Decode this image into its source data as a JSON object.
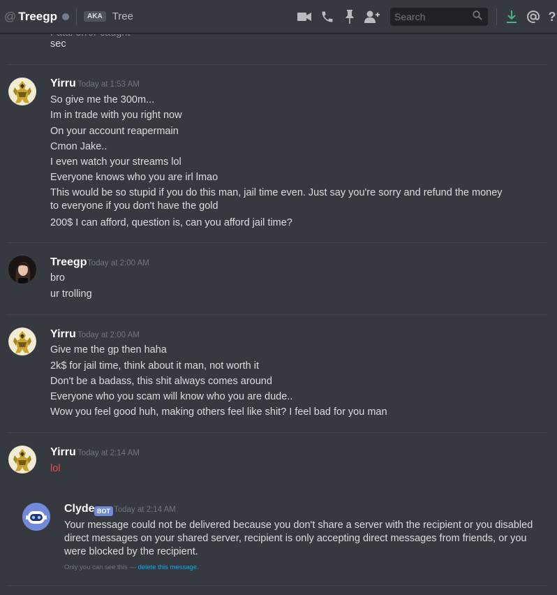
{
  "header": {
    "at": "@",
    "name": "Treegp",
    "aka_badge": "AKA",
    "aka_name": "Tree",
    "search_placeholder": "Search",
    "help": "?"
  },
  "messages": {
    "top_cut_text": "sec",
    "g1": {
      "author": "Yirru",
      "time": "Today at 1:53 AM",
      "lines": [
        "So give me the 300m...",
        "Im in trade with you right now",
        "On your account reapermain",
        "Cmon Jake..",
        "I even watch your streams lol",
        "Everyone knows who you are irl lmao",
        "This would be so stupid if you do this man, jail time even. Just say you're sorry and refund the money to everyone if you don't have the gold",
        "200$ I can afford, question is, can you afford jail time?"
      ]
    },
    "g2": {
      "author": "Treegp",
      "time": "Today at 2:00 AM",
      "lines": [
        "bro",
        "ur trolling"
      ]
    },
    "g3": {
      "author": "Yirru",
      "time": "Today at 2:00 AM",
      "lines": [
        "Give me the gp then haha",
        "2k$ for jail time, think about it man, not worth it",
        "Don't be a badass, this shit always comes around",
        "Everyone who you scam will know who you are dude..",
        "Wow you feel good huh, making others feel like shit? I feel bad for you man"
      ]
    },
    "g4": {
      "author": "Yirru",
      "time": "Today at 2:14 AM",
      "lines": [
        "lol"
      ]
    },
    "clyde": {
      "author": "Clyde",
      "badge": "BOT",
      "time": "Today at 2:14 AM",
      "text": "Your message could not be delivered because you don't share a server with the recipient or you disabled direct messages on your shared server, recipient is only accepting direct messages from friends, or you were blocked by the recipient.",
      "ephemeral_note": "Only you can see this — ",
      "ephemeral_link": "delete this message."
    }
  },
  "colors": {
    "background": "#36393f",
    "text": "#dcddde",
    "username": "#ffffff",
    "timestamp": "#72767d",
    "failed_message": "#f04747",
    "bot_badge": "#7289da",
    "link": "#00b0f4",
    "download_icon": "#43b581"
  },
  "icons": [
    "video-call-icon",
    "phone-call-icon",
    "pin-icon",
    "add-friend-icon",
    "search-icon",
    "download-icon",
    "mention-icon",
    "help-icon"
  ]
}
